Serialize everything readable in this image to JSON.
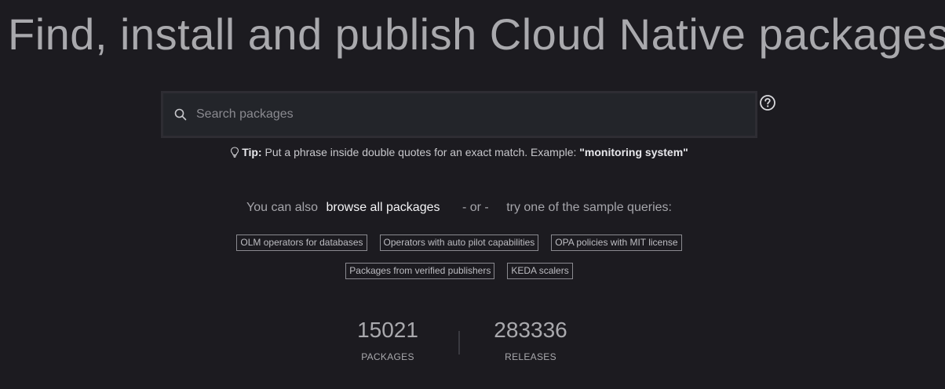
{
  "hero": {
    "title": "Find, install and publish Cloud Native packages"
  },
  "search": {
    "placeholder": "Search packages",
    "value": "",
    "icon": "search-icon",
    "help_icon": "question-circle-icon"
  },
  "tip": {
    "label": "Tip:",
    "text": "Put a phrase inside double quotes for an exact match. Example:",
    "example": "\"monitoring system\"",
    "icon": "lightbulb-icon"
  },
  "browse": {
    "prefix": "You can also",
    "link": "browse all packages",
    "separator": "- or -",
    "suffix": "try one of the sample queries:"
  },
  "sample_queries": {
    "row1": [
      "OLM operators for databases",
      "Operators with auto pilot capabilities",
      "OPA policies with MIT license"
    ],
    "row2": [
      "Packages from verified publishers",
      "KEDA scalers"
    ]
  },
  "stats": {
    "packages": {
      "value": "15021",
      "label": "PACKAGES"
    },
    "releases": {
      "value": "283336",
      "label": "RELEASES"
    }
  },
  "colors": {
    "background": "#1c1b20",
    "search_background": "#23252a",
    "text": "#a9a9ad",
    "link": "#f4f4f6"
  }
}
